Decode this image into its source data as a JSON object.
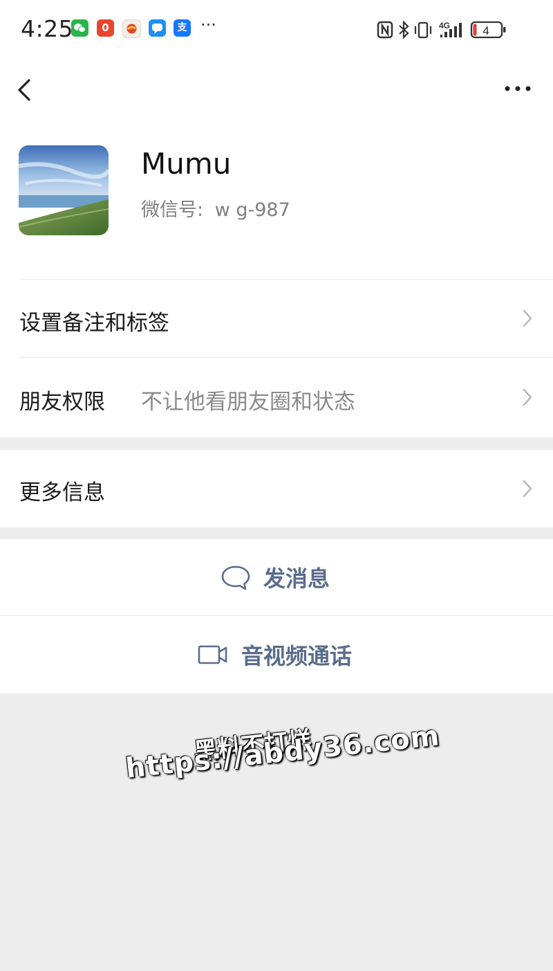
{
  "status_bar": {
    "time": "4:25",
    "notification_icons": [
      "wechat-icon",
      "notification-app-icon",
      "taobao-icon",
      "messages-icon",
      "alipay-icon"
    ],
    "orange_badge": "0",
    "alipay_glyph": "支",
    "more": "···",
    "battery": "4",
    "network": "4G",
    "system_icons": [
      "nfc-icon",
      "bluetooth-icon",
      "vibrate-icon",
      "signal-icon",
      "battery-icon"
    ]
  },
  "nav": {
    "back_icon": "back-arrow-icon",
    "more_icon": "more-dots-icon"
  },
  "profile": {
    "name": "Mumu",
    "wxid_label": "微信号:",
    "wxid_value": "w       g-987"
  },
  "rows": {
    "remark": {
      "label": "设置备注和标签"
    },
    "permission": {
      "label": "朋友权限",
      "value": "不让他看朋友圈和状态"
    },
    "more_info": {
      "label": "更多信息"
    }
  },
  "actions": {
    "message": {
      "label": "发消息",
      "icon": "chat-bubble-icon"
    },
    "call": {
      "label": "音视频通话",
      "icon": "video-camera-icon"
    }
  },
  "watermark": {
    "line1": "黑料不打烊",
    "line2": "https://abdy36.com"
  },
  "colors": {
    "page_bg": "#ededed",
    "card_bg": "#ffffff",
    "action_text": "#5a6c8c",
    "secondary_text": "#8a8a8a"
  }
}
